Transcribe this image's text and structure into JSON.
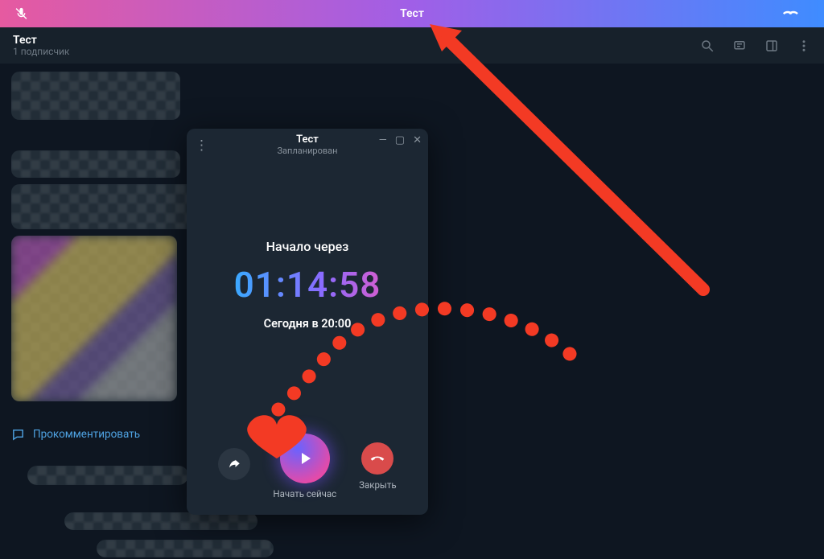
{
  "call_bar": {
    "title": "Тест",
    "mic_icon": "mic-muted-icon",
    "hang_icon": "hangup-icon"
  },
  "chat_header": {
    "title": "Тест",
    "subtitle": "1 подписчик",
    "icons": {
      "search": "search-icon",
      "stream": "stream-chat-icon",
      "panel": "side-panel-icon",
      "menu": "more-vert-icon"
    }
  },
  "comment_link": {
    "label": "Прокомментировать",
    "icon": "comment-bubble-icon"
  },
  "popup": {
    "title": "Тест",
    "status": "Запланирован",
    "start_label": "Начало через",
    "countdown": "01:14:58",
    "when": "Сегодня в 20:00",
    "actions": {
      "share": {
        "icon": "share-icon",
        "label": ""
      },
      "start": {
        "icon": "play-icon",
        "label": "Начать сейчас"
      },
      "close": {
        "icon": "hangup-icon",
        "label": "Закрыть"
      }
    },
    "window_controls": {
      "menu": "⋮",
      "min": "—",
      "max": "▢",
      "close": "✕"
    }
  },
  "annotation": {
    "arrow": "red-arrow",
    "dots": "red-dotted-curve"
  },
  "colors": {
    "accent_gradient_from": "#e65aa0",
    "accent_gradient_to": "#3f8cff",
    "red": "#f33a24"
  }
}
